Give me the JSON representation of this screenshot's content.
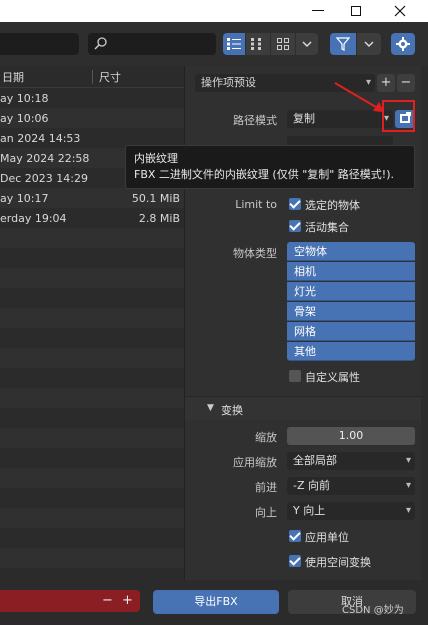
{
  "panel": {
    "preset_label": "操作项预设",
    "path_mode_label": "路径模式",
    "path_mode_value": "复制",
    "limit_to_label": "Limit to",
    "limit_options": [
      {
        "label": "选定的物体",
        "checked": true
      },
      {
        "label": "活动集合",
        "checked": true
      }
    ],
    "object_types_label": "物体类型",
    "object_types": [
      "空物体",
      "相机",
      "灯光",
      "骨架",
      "网格",
      "其他"
    ],
    "custom_props_label": "自定义属性",
    "transform_section": "变换",
    "scale_label": "缩放",
    "scale_value": "1.00",
    "apply_scale_label": "应用缩放",
    "apply_scale_value": "全部局部",
    "forward_label": "前进",
    "forward_value": "-Z 向前",
    "up_label": "向上",
    "up_value": "Y 向上",
    "apply_unit_label": "应用单位",
    "use_space_transform_label": "使用空间变换"
  },
  "tooltip": {
    "title": "内嵌纹理",
    "body": "FBX 二进制文件的内嵌纹理 (仅供 \"复制\" 路径模式!)."
  },
  "filebrowser": {
    "col_date": "日期",
    "col_size": "尺寸",
    "rows": [
      {
        "date": "ay 10:18",
        "size": ""
      },
      {
        "date": "ay 10:06",
        "size": ""
      },
      {
        "date": "an 2024 14:53",
        "size": ""
      },
      {
        "date": "May 2024 22:58",
        "size": ""
      },
      {
        "date": "Dec 2023 14:29",
        "size": ""
      },
      {
        "date": "ay 10:17",
        "size": "50.1 MiB"
      },
      {
        "date": "erday 19:04",
        "size": "2.8 MiB"
      }
    ]
  },
  "footer": {
    "export_label": "导出FBX",
    "cancel_label": "取消",
    "watermark": "CSDN @妙为"
  },
  "colors": {
    "accent": "#4772b3",
    "highlight_box": "#e02020",
    "filename_field": "#8a1e22"
  }
}
